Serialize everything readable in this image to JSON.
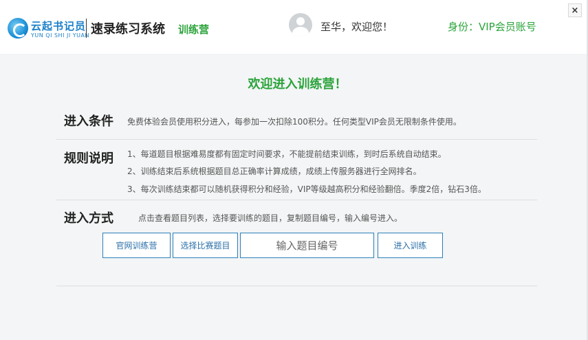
{
  "header": {
    "logo_cn": "云起书记员",
    "logo_en": "YUN QI SHI JI YUAN",
    "app_title": "速录练习系统",
    "app_subtitle": "训练营",
    "welcome_user": "至华，欢迎您！",
    "identity": "身份：VIP会员账号",
    "close_label": "×"
  },
  "main": {
    "title": "欢迎进入训练营！",
    "sections": [
      {
        "label": "进入条件",
        "lines": [
          "免费体验会员使用积分进入，每参加一次扣除100积分。任何类型VIP会员无限制条件使用。"
        ]
      },
      {
        "label": "规则说明",
        "lines": [
          "1、每道题目根据难易度都有固定时间要求，不能提前结束训练，到时后系统自动结束。",
          "2、训练结束后系统根据题目总正确率计算成绩，成绩上传服务器进行全网排名。",
          "3、每次训练结束都可以随机获得积分和经验，VIP等级越高积分和经验翻倍。季度2倍，钻石3倍。"
        ]
      },
      {
        "label": "进入方式",
        "lines": [
          "点击查看题目列表，选择要训练的题目，复制题目编号，输入编号进入。"
        ]
      }
    ],
    "buttons": {
      "official": "官网训练营",
      "choose": "选择比赛题目",
      "enter": "进入训练"
    },
    "code_input": {
      "placeholder": "输入题目编号",
      "value": ""
    }
  }
}
